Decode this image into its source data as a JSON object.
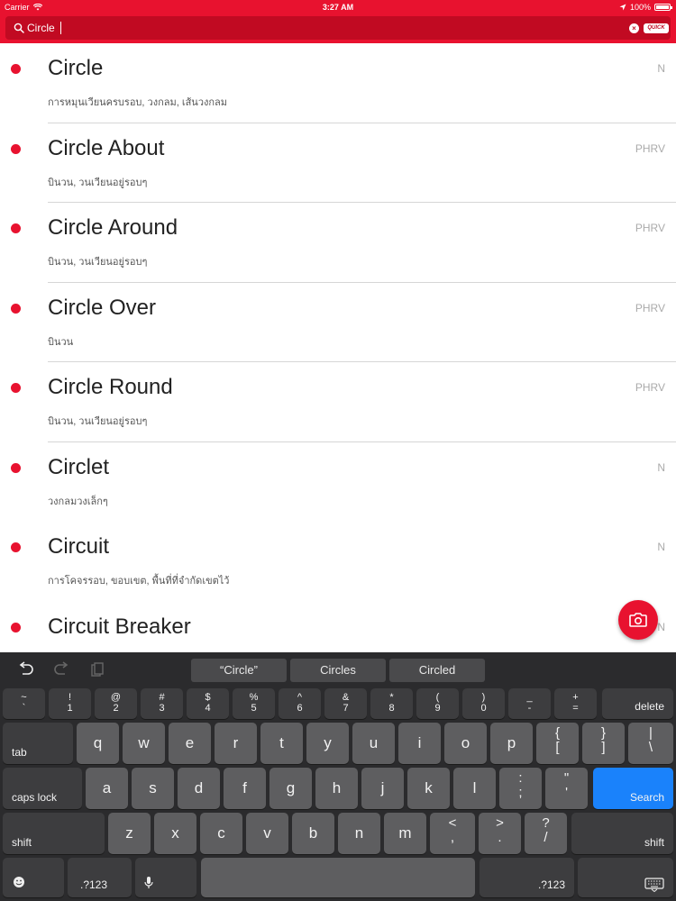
{
  "status_bar": {
    "carrier": "Carrier",
    "time": "3:27 AM",
    "battery": "100%"
  },
  "search": {
    "query": "Circle",
    "quick_label": "QUICK",
    "clear": "×"
  },
  "entries": [
    {
      "word": "Circle",
      "pos": "N",
      "meaning": "การหมุนเวียนครบรอบ, วงกลม, เส้นวงกลม"
    },
    {
      "word": "Circle About",
      "pos": "PHRV",
      "meaning": "บินวน, วนเวียนอยู่รอบๆ"
    },
    {
      "word": "Circle Around",
      "pos": "PHRV",
      "meaning": "บินวน, วนเวียนอยู่รอบๆ"
    },
    {
      "word": "Circle Over",
      "pos": "PHRV",
      "meaning": "บินวน"
    },
    {
      "word": "Circle Round",
      "pos": "PHRV",
      "meaning": "บินวน, วนเวียนอยู่รอบๆ"
    },
    {
      "word": "Circlet",
      "pos": "N",
      "meaning": "วงกลมวงเล็กๆ"
    },
    {
      "word": "Circuit",
      "pos": "N",
      "meaning": "การโคจรรอบ, ขอบเขต, พื้นที่ที่จำกัดเขตไว้"
    },
    {
      "word": "Circuit Breaker",
      "pos": "N",
      "meaning": ""
    }
  ],
  "keyboard": {
    "suggestions": [
      "“Circle”",
      "Circles",
      "Circled"
    ],
    "num_row": [
      {
        "top": "~",
        "bot": "`"
      },
      {
        "top": "!",
        "bot": "1"
      },
      {
        "top": "@",
        "bot": "2"
      },
      {
        "top": "#",
        "bot": "3"
      },
      {
        "top": "$",
        "bot": "4"
      },
      {
        "top": "%",
        "bot": "5"
      },
      {
        "top": "^",
        "bot": "6"
      },
      {
        "top": "&",
        "bot": "7"
      },
      {
        "top": "*",
        "bot": "8"
      },
      {
        "top": "(",
        "bot": "9"
      },
      {
        "top": ")",
        "bot": "0"
      },
      {
        "top": "_",
        "bot": "-"
      },
      {
        "top": "+",
        "bot": "="
      }
    ],
    "delete": "delete",
    "tab": "tab",
    "row_q": [
      "q",
      "w",
      "e",
      "r",
      "t",
      "y",
      "u",
      "i",
      "o",
      "p"
    ],
    "row_q_sym": [
      {
        "top": "{",
        "bot": "["
      },
      {
        "top": "}",
        "bot": "]"
      },
      {
        "top": "|",
        "bot": "\\"
      }
    ],
    "caps_lock": "caps lock",
    "row_a": [
      "a",
      "s",
      "d",
      "f",
      "g",
      "h",
      "j",
      "k",
      "l"
    ],
    "row_a_sym": [
      {
        "top": ":",
        "bot": ";"
      },
      {
        "top": "\"",
        "bot": "'"
      }
    ],
    "search": "Search",
    "shift": "shift",
    "row_z": [
      "z",
      "x",
      "c",
      "v",
      "b",
      "n",
      "m"
    ],
    "row_z_sym": [
      {
        "top": "<",
        "bot": ","
      },
      {
        "top": ">",
        "bot": "."
      },
      {
        "top": "?",
        "bot": "/"
      }
    ],
    "numbers": ".?123"
  },
  "colors": {
    "accent": "#e8122f",
    "search_bg": "#c10a22",
    "keyboard_bg": "#2b2b2d",
    "key": "#5e5e60",
    "search_key": "#1a82fb"
  }
}
